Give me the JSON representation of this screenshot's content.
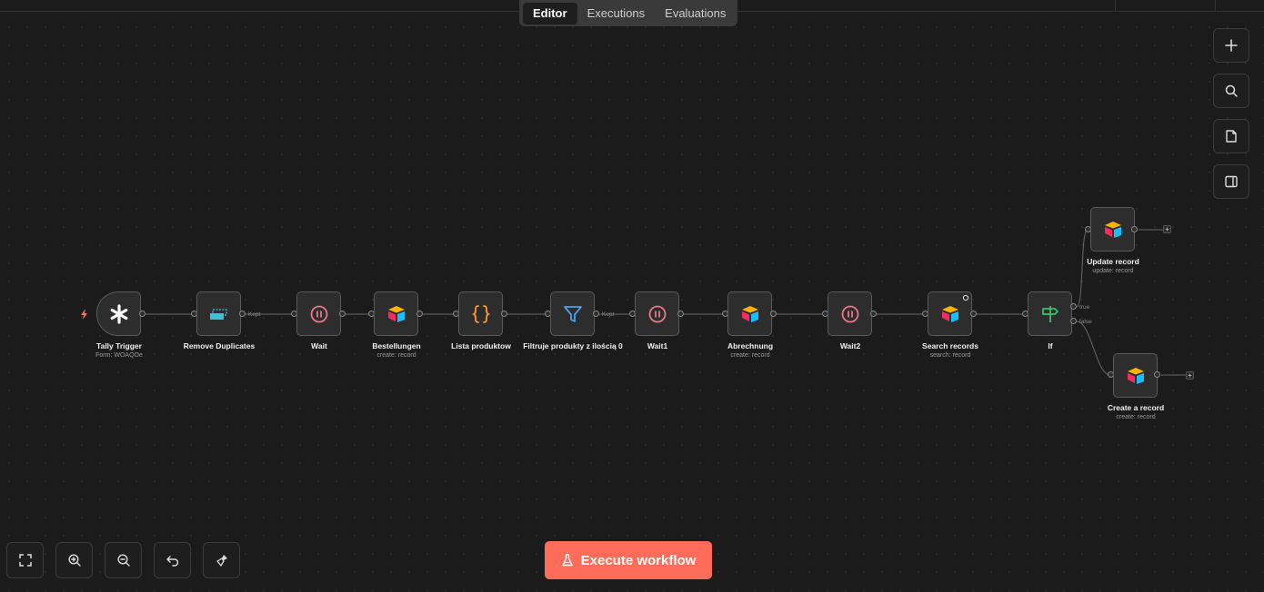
{
  "tabs": [
    {
      "label": "Editor",
      "active": true
    },
    {
      "label": "Executions"
    },
    {
      "label": "Evaluations"
    }
  ],
  "side_toolbar": [
    {
      "icon": "plus-icon"
    },
    {
      "icon": "search-icon"
    },
    {
      "icon": "sticky-note-icon"
    },
    {
      "icon": "panel-toggle-icon"
    }
  ],
  "nodes": {
    "tally": {
      "label": "Tally Trigger",
      "sub": "Form: WOAQOe",
      "icon": "asterisk-icon"
    },
    "dedupe": {
      "label": "Remove Duplicates",
      "sub": "",
      "icon": "remove-duplicates-icon"
    },
    "wait": {
      "label": "Wait",
      "sub": "",
      "icon": "pause-icon"
    },
    "bestellungen": {
      "label": "Bestellungen",
      "sub": "create: record",
      "icon": "airtable-icon"
    },
    "lista": {
      "label": "Lista produktow",
      "sub": "",
      "icon": "code-braces-icon"
    },
    "filtruje": {
      "label": "Filtruje produkty z ilością 0",
      "sub": "",
      "icon": "filter-icon"
    },
    "wait1": {
      "label": "Wait1",
      "sub": "",
      "icon": "pause-icon"
    },
    "abrechnung": {
      "label": "Abrechnung",
      "sub": "create: record",
      "icon": "airtable-icon"
    },
    "wait2": {
      "label": "Wait2",
      "sub": "",
      "icon": "pause-icon"
    },
    "search": {
      "label": "Search records",
      "sub": "search: record",
      "icon": "airtable-icon"
    },
    "if": {
      "label": "If",
      "sub": "",
      "icon": "signpost-icon"
    },
    "update": {
      "label": "Update record",
      "sub": "update: record",
      "icon": "airtable-icon"
    },
    "create": {
      "label": "Create a record",
      "sub": "create: record",
      "icon": "airtable-icon"
    }
  },
  "edge_labels": {
    "kept1": "Kept",
    "kept2": "Kept",
    "true": "true",
    "false": "false",
    "plus": "+"
  },
  "bottom_toolbar": [
    {
      "icon": "fit-view-icon"
    },
    {
      "icon": "zoom-in-icon"
    },
    {
      "icon": "zoom-out-icon"
    },
    {
      "icon": "undo-icon"
    },
    {
      "icon": "clean-up-icon"
    }
  ],
  "execute_button": {
    "label": "Execute workflow",
    "icon": "flask-icon"
  },
  "colors": {
    "accent": "#ff6d5a",
    "wait_icon": "#e8788a",
    "code_icon": "#ff9b26",
    "filter_icon": "#4aa3f0",
    "if_icon": "#35c46f",
    "dedupe_icon": "#3fc0d9"
  }
}
